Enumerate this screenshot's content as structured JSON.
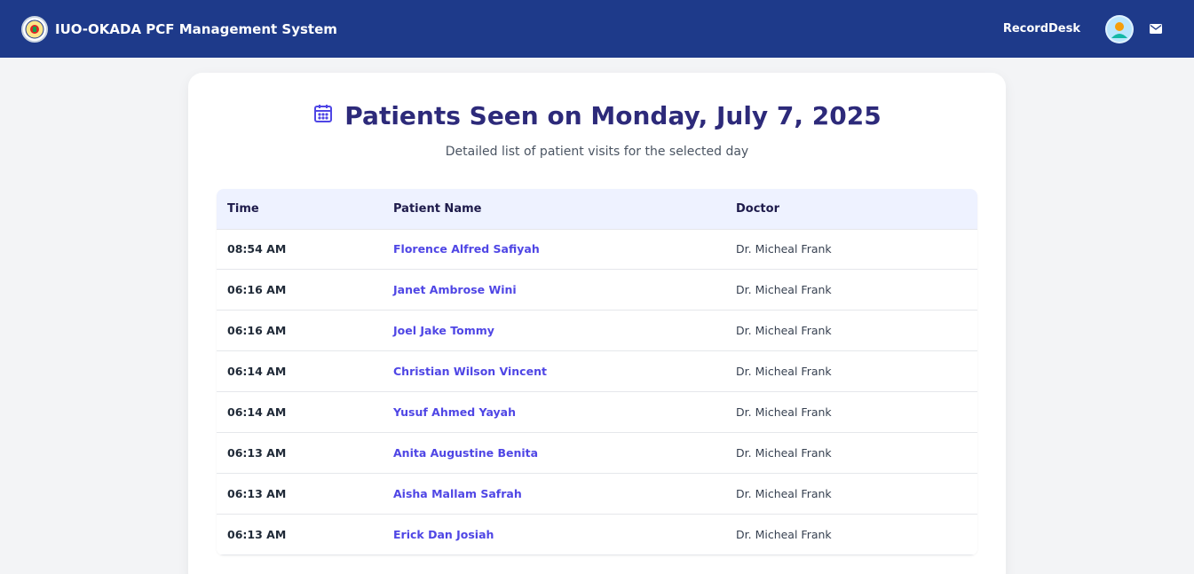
{
  "navbar": {
    "title": "IUO-OKADA PCF Management System",
    "app_name": "RecordDesk",
    "brand_color": "#1e3a8a"
  },
  "page": {
    "title": "Patients Seen on Monday, July 7, 2025",
    "subtitle": "Detailed list of patient visits for the selected day",
    "title_icon": "calendar-icon"
  },
  "table": {
    "headers": [
      "Time",
      "Patient Name",
      "Doctor"
    ],
    "rows": [
      {
        "time": "08:54 AM",
        "name": "Florence Alfred Safiyah",
        "doctor": "Dr. Micheal Frank"
      },
      {
        "time": "06:16 AM",
        "name": "Janet Ambrose Wini",
        "doctor": "Dr. Micheal Frank"
      },
      {
        "time": "06:16 AM",
        "name": "Joel Jake Tommy",
        "doctor": "Dr. Micheal Frank"
      },
      {
        "time": "06:14 AM",
        "name": "Christian Wilson Vincent",
        "doctor": "Dr. Micheal Frank"
      },
      {
        "time": "06:14 AM",
        "name": "Yusuf Ahmed Yayah",
        "doctor": "Dr. Micheal Frank"
      },
      {
        "time": "06:13 AM",
        "name": "Anita Augustine Benita",
        "doctor": "Dr. Micheal Frank"
      },
      {
        "time": "06:13 AM",
        "name": "Aisha Mallam Safrah",
        "doctor": "Dr. Micheal Frank"
      },
      {
        "time": "06:13 AM",
        "name": "Erick Dan Josiah",
        "doctor": "Dr. Micheal Frank"
      }
    ]
  }
}
